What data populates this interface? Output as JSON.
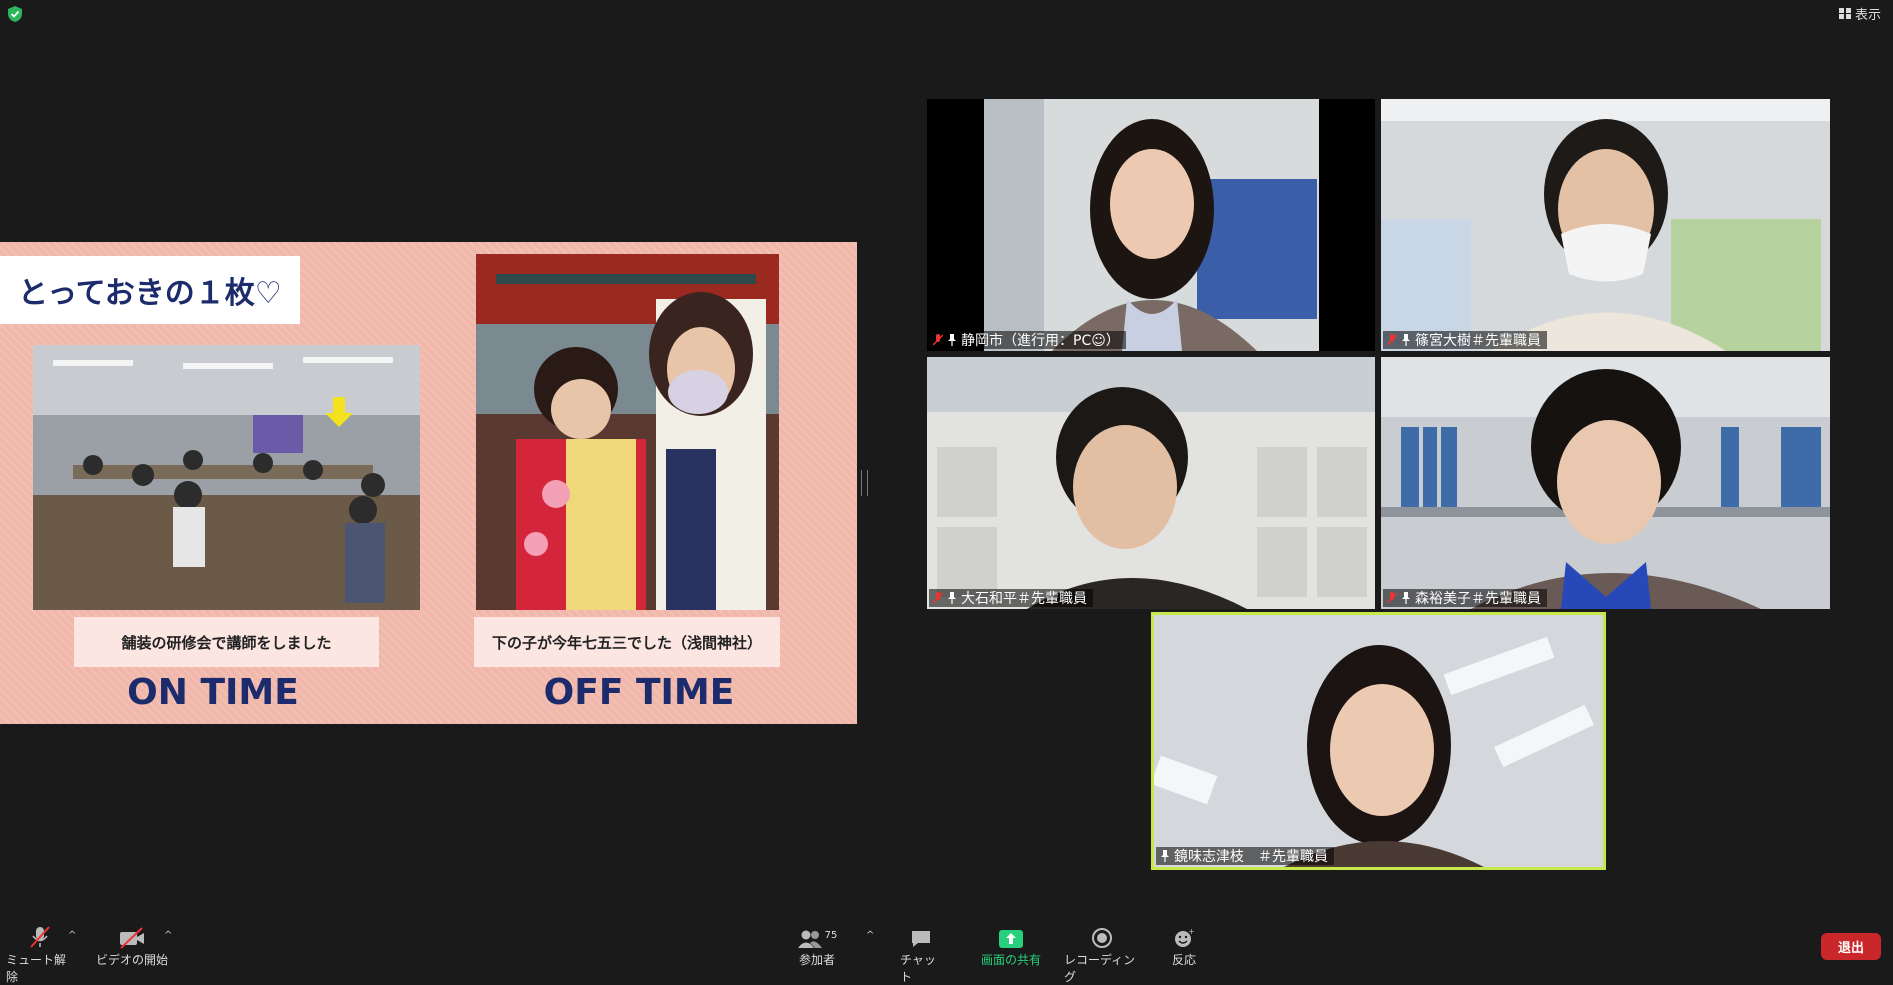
{
  "topbar": {
    "view_label": "表示"
  },
  "slide": {
    "title": "とっておきの１枚♡",
    "left_caption": "舗装の研修会で講師をしました",
    "right_caption": "下の子が今年七五三でした（浅間神社）",
    "on_time_label": "ON TIME",
    "off_time_label": "OFF TIME"
  },
  "participants": [
    {
      "name": "静岡市（進行用：PC☺）",
      "muted": true
    },
    {
      "name": "篠宮大樹＃先輩職員",
      "muted": true
    },
    {
      "name": "大石和平＃先輩職員",
      "muted": true
    },
    {
      "name": "森裕美子＃先輩職員",
      "muted": true
    },
    {
      "name": "鏡味志津枝　＃先輩職員",
      "muted": false,
      "active_speaker": true
    }
  ],
  "toolbar": {
    "mute_label": "ミュート解除",
    "video_label": "ビデオの開始",
    "participants_label": "参加者",
    "participants_count": "75",
    "chat_label": "チャット",
    "share_label": "画面の共有",
    "record_label": "レコーディング",
    "reactions_label": "反応",
    "exit_label": "退出"
  },
  "colors": {
    "background": "#1a1a1a",
    "slide_bg": "#f0b7aa",
    "slide_text": "#1c2b6b",
    "active_border": "#c6e84a",
    "share_green": "#26d07c",
    "exit_red": "#c9272a"
  }
}
